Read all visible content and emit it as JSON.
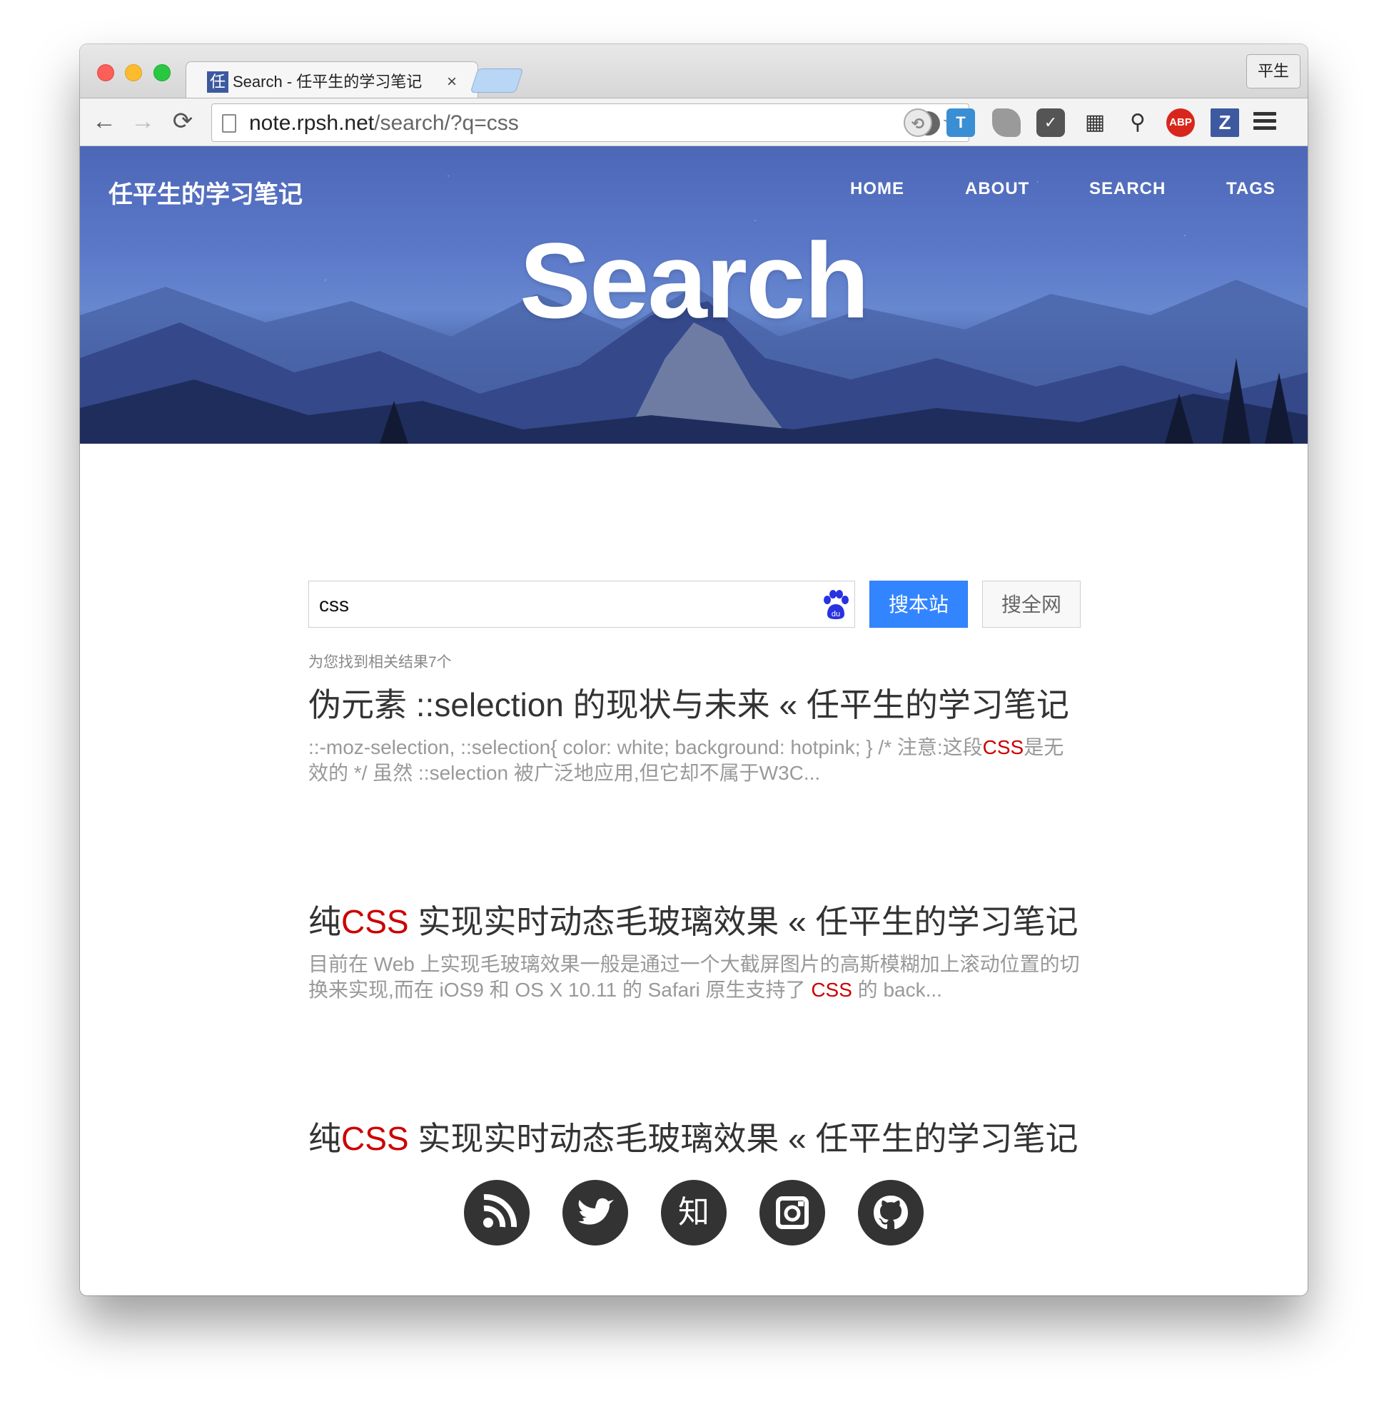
{
  "browser": {
    "tab_title": "Search - 任平生的学习笔记",
    "tab_favicon_char": "任",
    "tab_close": "×",
    "profile_name": "平生",
    "url_host": "note.rpsh.net",
    "url_path": "/search/?q=css",
    "nav_back": "←",
    "nav_forward": "→",
    "nav_reload": "⟳",
    "extensions": [
      "sync-icon",
      "t-icon",
      "leaf-icon",
      "pocket-icon",
      "qr-icon",
      "wand-icon",
      "adblock-icon",
      "z-icon"
    ],
    "ext_labels": {
      "t": "T",
      "abp": "ABP",
      "z": "Z",
      "qr": "▦",
      "wand": "⚲",
      "sync": "⟲"
    }
  },
  "header": {
    "brand": "任平生的学习笔记",
    "nav": [
      "HOME",
      "ABOUT",
      "SEARCH",
      "TAGS"
    ],
    "title": "Search"
  },
  "search": {
    "query": "css",
    "btn_site": "搜本站",
    "btn_web": "搜全网",
    "result_count": "为您找到相关结果7个"
  },
  "results": [
    {
      "title_before": "伪元素 ::selection 的现状与未来 « 任平生的学习笔记",
      "title_hl": "",
      "title_after": "",
      "snippet_before": "::-moz-selection, ::selection{ color: white; background: hotpink; } /* 注意:这段",
      "snippet_hl": "CSS",
      "snippet_after": "是无效的 */ 虽然 ::selection 被广泛地应用,但它却不属于W3C..."
    },
    {
      "title_before": "纯",
      "title_hl": "CSS",
      "title_after": " 实现实时动态毛玻璃效果 « 任平生的学习笔记",
      "snippet_before": "目前在 Web 上实现毛玻璃效果一般是通过一个大截屏图片的高斯模糊加上滚动位置的切换来实现,而在 iOS9 和 OS X 10.11 的 Safari 原生支持了 ",
      "snippet_hl": "CSS",
      "snippet_after": " 的 back..."
    },
    {
      "title_before": "纯",
      "title_hl": "CSS",
      "title_after": " 实现实时动态毛玻璃效果 « 任平生的学习笔记"
    }
  ],
  "footer": {
    "socials": [
      "rss-icon",
      "twitter-icon",
      "zhihu-icon",
      "instagram-icon",
      "github-icon"
    ],
    "zhihu_char": "知"
  },
  "colors": {
    "accent": "#3385ff",
    "highlight": "#cc0000",
    "hero": "#5b78c8"
  }
}
